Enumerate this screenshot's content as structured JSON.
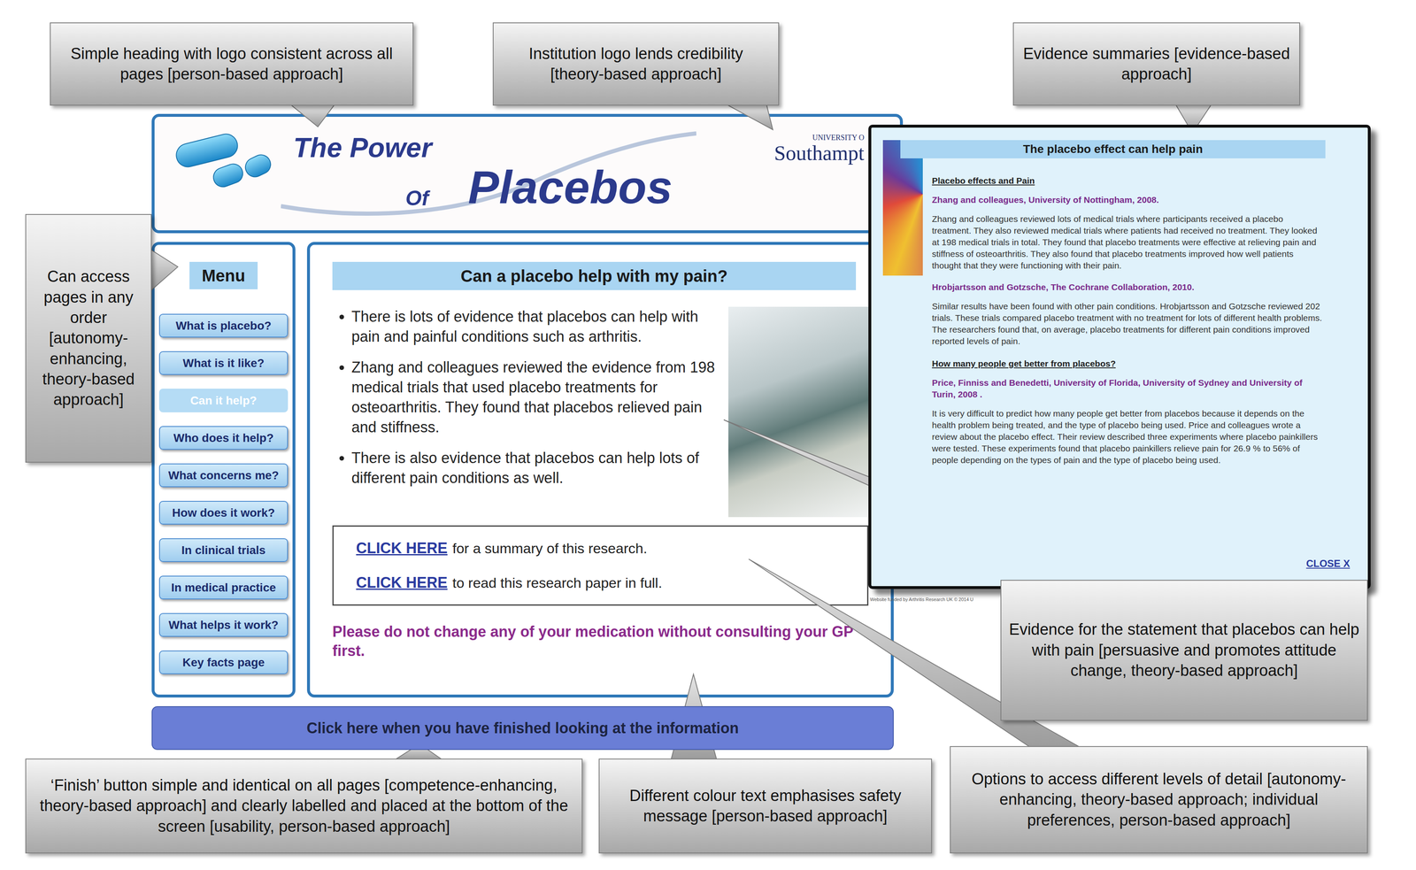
{
  "callouts": [
    {
      "text": "Simple heading with logo consistent across all pages [person-based approach]"
    },
    {
      "text": "Institution logo lends credibility [theory-based approach]"
    },
    {
      "text": "Evidence summaries [evidence-based approach]"
    },
    {
      "text": "Can access pages in any order [autonomy-enhancing, theory-based approach]"
    },
    {
      "text": "Evidence for the statement that placebos can help with pain [persuasive and promotes attitude change, theory-based approach]"
    },
    {
      "text": "Options to access different levels of detail [autonomy-enhancing, theory-based approach; individual preferences, person-based approach]"
    },
    {
      "text": "‘Finish’ button simple and identical on all pages [competence-enhancing, theory-based approach] and clearly labelled and placed at the bottom of the screen [usability, person-based approach]"
    },
    {
      "text": "Different colour text emphasises safety message [person-based approach]"
    }
  ],
  "header": {
    "title_line1": "The Power",
    "title_of": "Of",
    "title_main": "Placebos",
    "logo_small": "UNIVERSITY O",
    "logo_name": "Southampt"
  },
  "menu": {
    "label": "Menu",
    "items": [
      {
        "label": "What is placebo?",
        "selected": false
      },
      {
        "label": "What is it like?",
        "selected": false
      },
      {
        "label": "Can it help?",
        "selected": true
      },
      {
        "label": "Who does it help?",
        "selected": false
      },
      {
        "label": "What concerns me?",
        "selected": false
      },
      {
        "label": "How does it work?",
        "selected": false
      },
      {
        "label": "In clinical trials",
        "selected": false
      },
      {
        "label": "In medical practice",
        "selected": false
      },
      {
        "label": "What helps it work?",
        "selected": false
      },
      {
        "label": "Key facts page",
        "selected": false
      }
    ]
  },
  "page": {
    "title": "Can a placebo help with my pain?",
    "bullets": [
      "There is lots of evidence that placebos can help with pain and painful conditions such as arthritis.",
      "Zhang and colleagues reviewed the evidence from 198 medical trials that used placebo treatments for osteoarthritis. They found that placebos relieved pain and stiffness.",
      "There is also evidence that placebos can help lots of different pain conditions as well."
    ],
    "links": [
      {
        "link": "CLICK HERE",
        "text": "for a summary of this research."
      },
      {
        "link": "CLICK HERE",
        "text": "to read this research paper in full."
      }
    ],
    "warning": "Please do not change any of your medication without consulting your GP first."
  },
  "finish_button": "Click here when you have finished looking at the information",
  "popup": {
    "title": "The placebo effect can help pain",
    "sections": [
      {
        "heading": "Placebo effects and Pain",
        "studies": [
          {
            "source": "Zhang and colleagues, University of Nottingham, 2008.",
            "summary": "Zhang and colleagues reviewed lots of medical trials where participants received a placebo treatment. They also reviewed medical trials where patients had received no treatment. They looked at 198 medical trials in total. They found that placebo treatments were effective at relieving pain and stiffness of osteoarthritis. They also found that placebo treatments improved how well patients thought that they were functioning with their pain."
          },
          {
            "source": "Hrobjartsson and Gotzsche, The Cochrane Collaboration, 2010.",
            "summary": "Similar results have been found with other pain conditions. Hrobjartsson and Gotzsche reviewed 202 trials. These trials compared placebo treatment with no treatment for lots of different health problems. The researchers found that, on average, placebo treatments for different pain conditions improved reported levels of pain."
          }
        ]
      },
      {
        "heading": "How many people get better from placebos?",
        "studies": [
          {
            "source": "Price, Finniss and Benedetti, University of Florida, University of Sydney and University of Turin, 2008 .",
            "summary": "It is very difficult to predict how many people get better from placebos because it depends on the health problem being treated, and the type of placebo being used. Price and colleagues wrote a review about the placebo effect. Their review described three experiments where placebo painkillers were tested. These experiments found that placebo painkillers relieve pain for 26.9 % to 56% of people depending on the types of pain and the type of placebo being used."
          }
        ]
      }
    ],
    "close": "CLOSE X",
    "footer": "Website funded by Arthritis Research UK © 2014 U"
  }
}
